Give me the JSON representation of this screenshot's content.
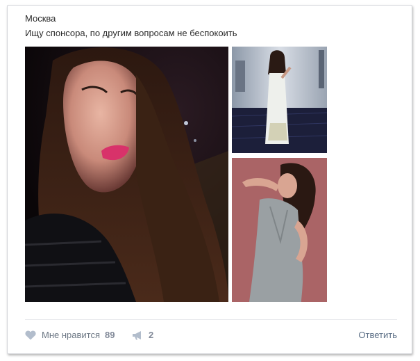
{
  "post": {
    "location": "Москва",
    "text": "Ищу спонсора, по другим вопросам не беспокоить",
    "photos": [
      {
        "name": "photo-selfie"
      },
      {
        "name": "photo-white-dress"
      },
      {
        "name": "photo-grey-dress"
      }
    ]
  },
  "actions": {
    "like_label": "Мне нравится",
    "like_count": "89",
    "share_count": "2",
    "reply_label": "Ответить",
    "like_icon": "heart-icon",
    "share_icon": "megaphone-icon"
  },
  "colors": {
    "text": "#2a2a2a",
    "action_text": "#6d7885",
    "count_text": "#828a99",
    "icon": "#b2bdcc",
    "link": "#5b6e85",
    "divider": "#e7e8ec",
    "border": "#d5d7db"
  }
}
